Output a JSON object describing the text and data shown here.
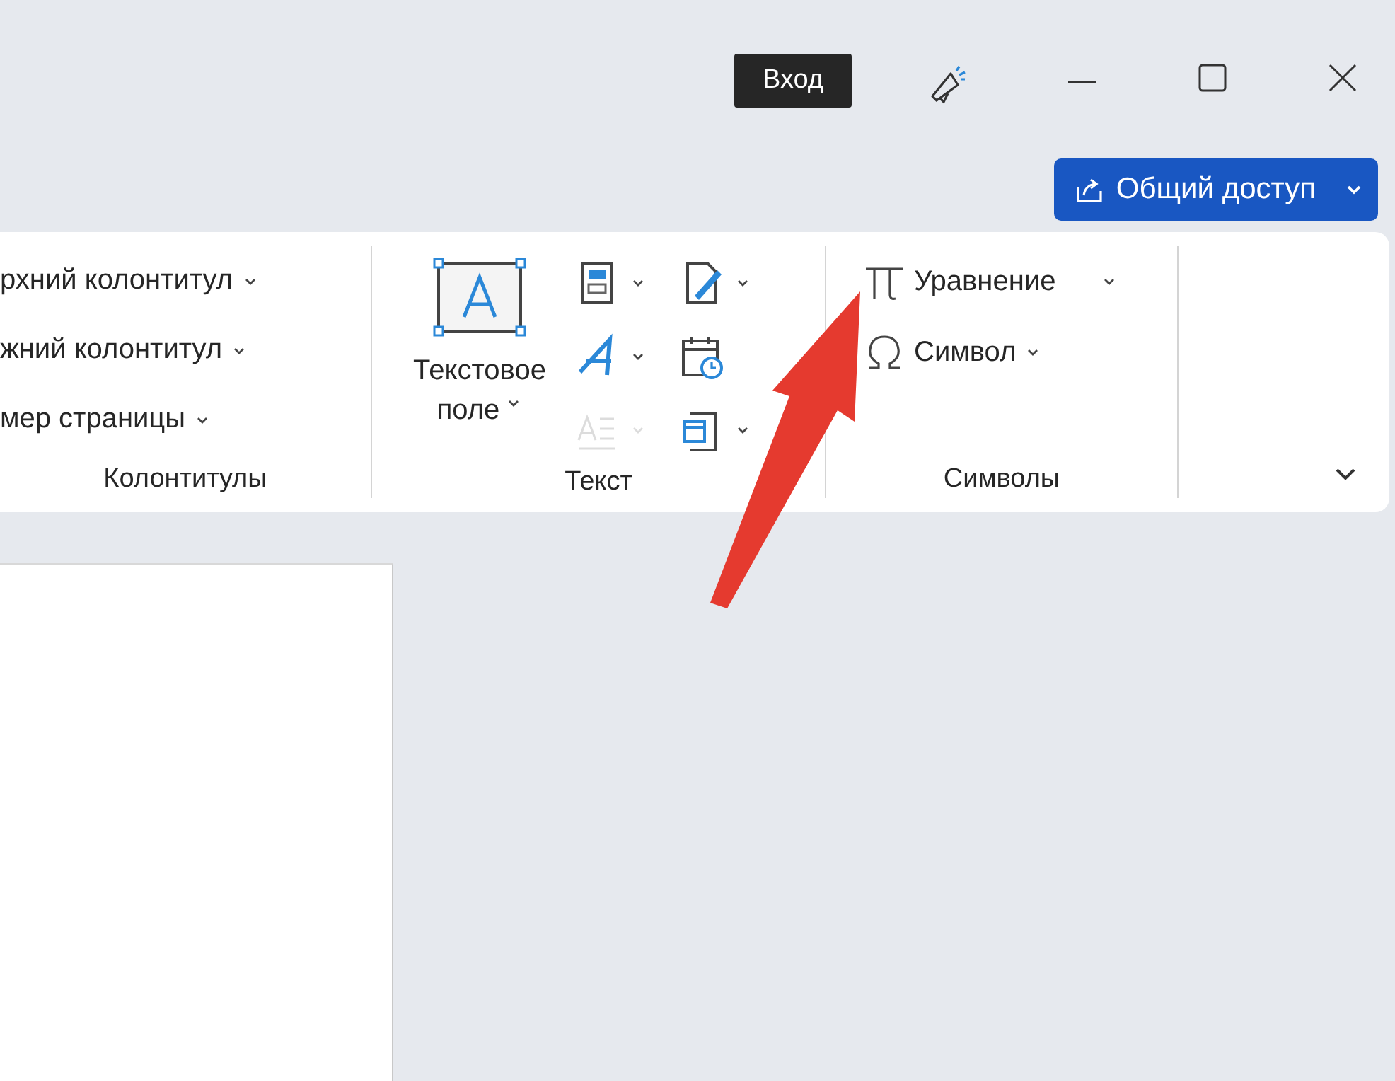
{
  "title_bar": {
    "sign_in": "Вход"
  },
  "share_button": {
    "label": "Общий доступ"
  },
  "ribbon": {
    "groups": [
      {
        "kind": "headers",
        "label": "Колонтитулы",
        "items": [
          {
            "label": "рхний колонтитул"
          },
          {
            "label": "жний колонтитул"
          },
          {
            "label": "мер страницы"
          }
        ]
      },
      {
        "kind": "text",
        "label": "Текст",
        "big_button": {
          "label_line_1": "Текстовое",
          "label_line_2": "поле"
        },
        "small_buttons": [
          {
            "kind": "quick-parts",
            "dropdown": true,
            "disabled": false
          },
          {
            "kind": "wordart",
            "dropdown": true,
            "disabled": false
          },
          {
            "kind": "dropcap",
            "dropdown": true,
            "disabled": true
          },
          {
            "kind": "signature",
            "dropdown": true,
            "disabled": false
          },
          {
            "kind": "datetime",
            "dropdown": false,
            "disabled": false
          },
          {
            "kind": "object",
            "dropdown": true,
            "disabled": false
          }
        ]
      },
      {
        "kind": "symbols",
        "label": "Символы",
        "items": [
          {
            "kind": "equation",
            "label": "Уравнение"
          },
          {
            "kind": "symbol",
            "label": "Символ"
          }
        ]
      }
    ]
  }
}
